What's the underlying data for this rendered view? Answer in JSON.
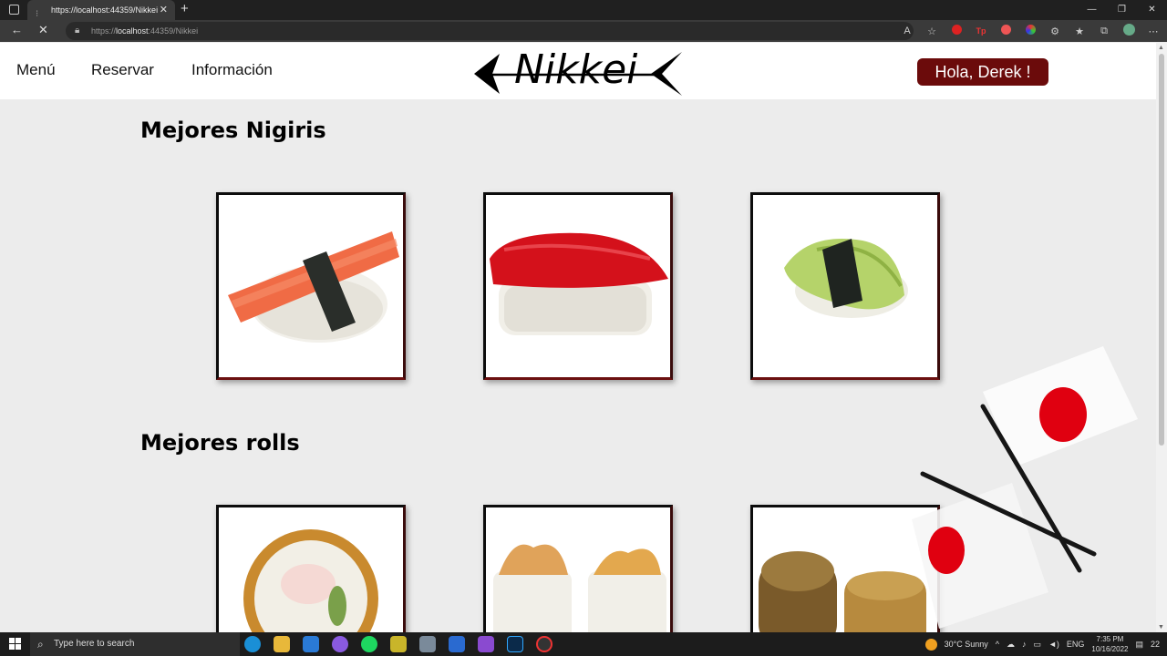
{
  "browser": {
    "tab_title": "https://localhost:44359/Nikkei",
    "url_scheme": "https://",
    "url_host": "localhost",
    "url_rest": ":44359/Nikkei"
  },
  "nav": {
    "menu": "Menú",
    "reservar": "Reservar",
    "informacion": "Información"
  },
  "logo": {
    "text": "Nikkei"
  },
  "user": {
    "greeting": "Hola, Derek !"
  },
  "sections": {
    "nigiris_title": "Mejores Nigiris",
    "rolls_title": "Mejores rolls"
  },
  "taskbar": {
    "search_placeholder": "Type here to search",
    "weather": "30°C  Sunny",
    "language": "ENG",
    "time": "7:35 PM",
    "date": "10/16/2022",
    "notifications": "22"
  },
  "colors": {
    "accent": "#6b0b0b",
    "page_bg": "#ececec"
  }
}
